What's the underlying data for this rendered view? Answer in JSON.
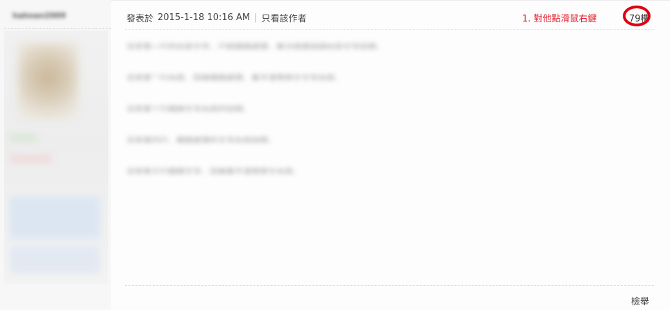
{
  "sidebar": {
    "username": "hahnan2009"
  },
  "post": {
    "meta_prefix": "發表於",
    "timestamp": "2015-1-18 10:16 AM",
    "only_author": "只看該作者",
    "annotation": "1. 對他點滑鼠右鍵",
    "floor": "79樓",
    "body_lines": [
      "這是第一行的內容文字，已經模糊處理，無法辨識詳細內容文字說明。",
      "這是第二行內容，同樣模糊處理，看不清楚原文文字內容。",
      "這是第三行模糊文字內容的說明。",
      "這是第四行，模糊處理的文字內容說明。",
      "這是第五行模糊文字，同樣看不清楚原文內容。"
    ],
    "report": "檢舉"
  },
  "colors": {
    "annotation": "#e0202f",
    "highlight_ring": "#e00010"
  }
}
